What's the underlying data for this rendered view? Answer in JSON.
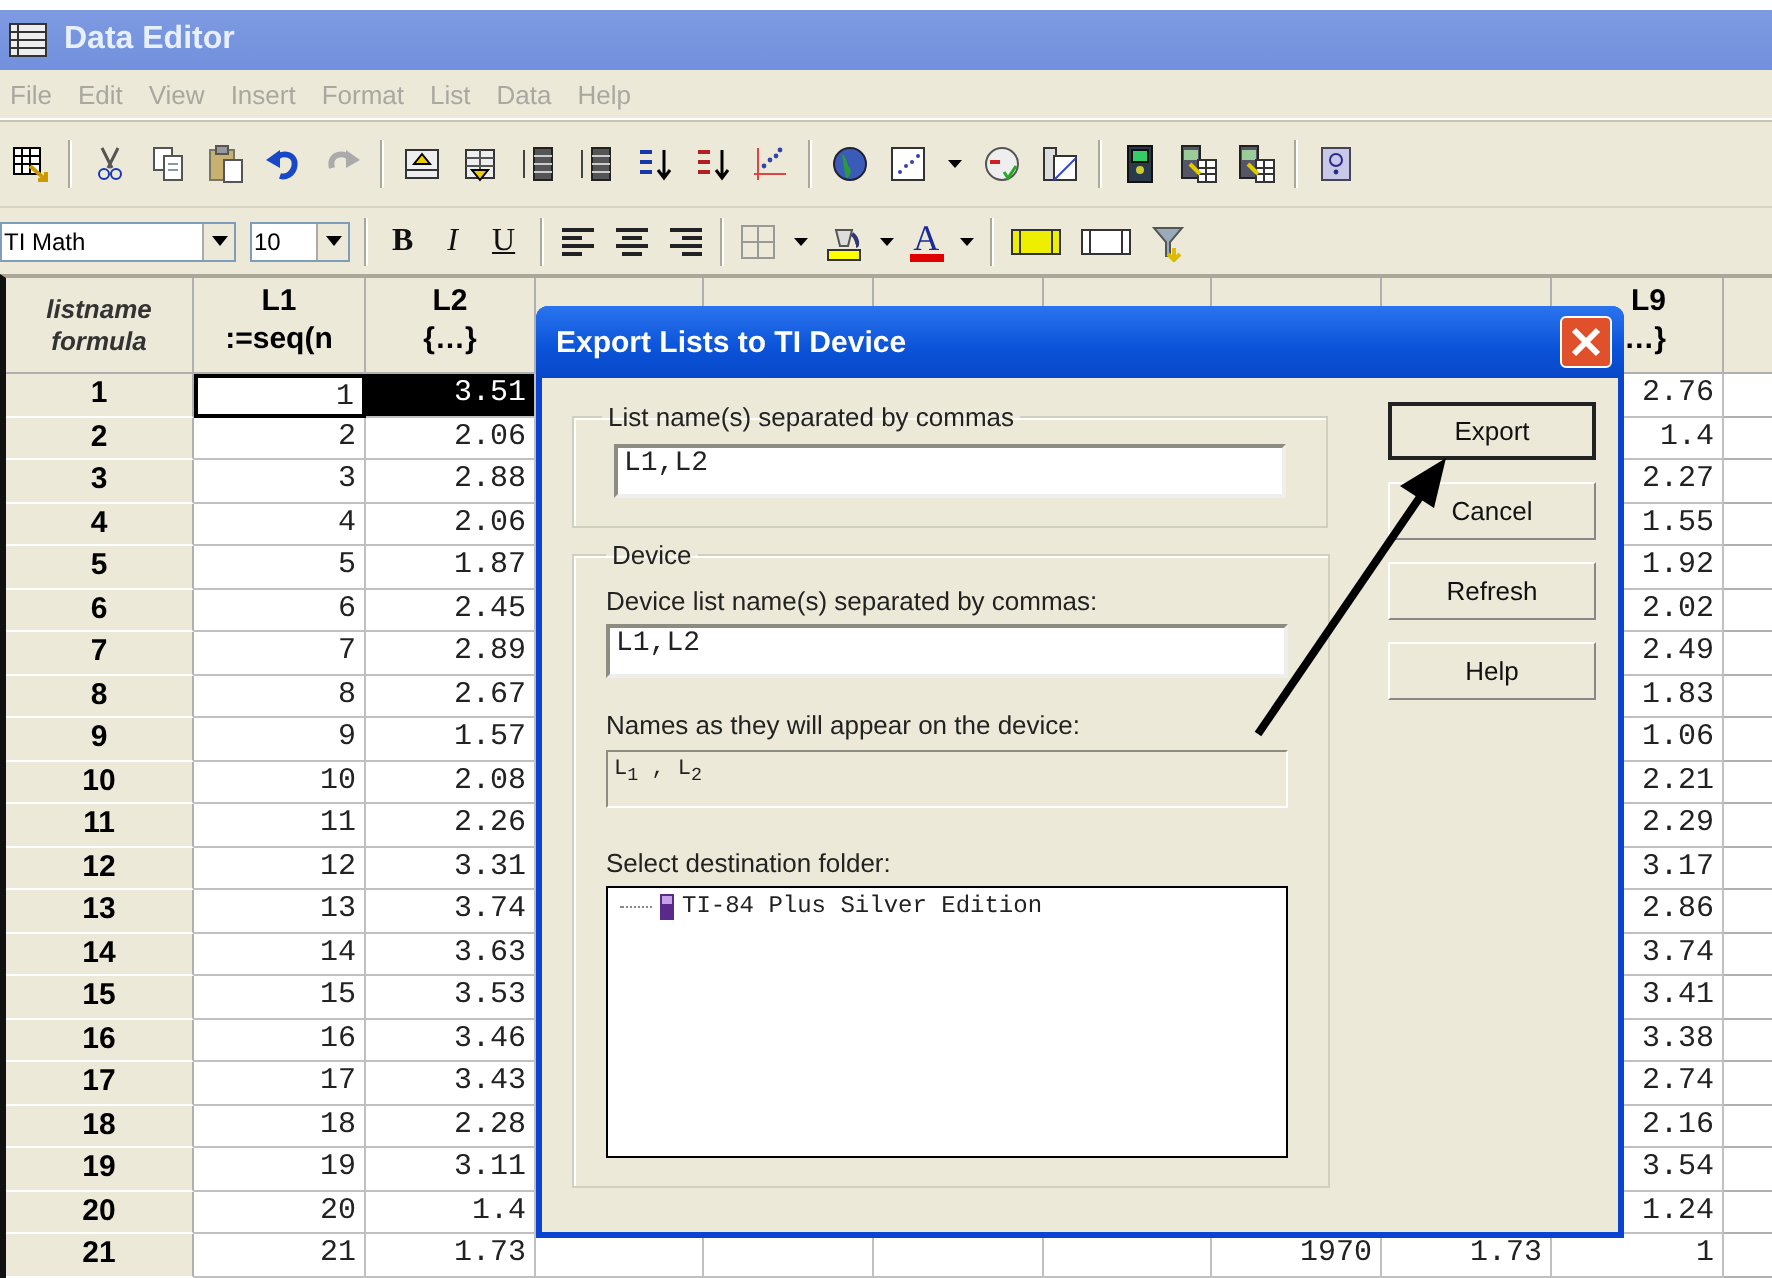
{
  "window": {
    "title": "Data Editor"
  },
  "menu": [
    "File",
    "Edit",
    "View",
    "Insert",
    "Format",
    "List",
    "Data",
    "Help"
  ],
  "font_box": {
    "value": "TI Math"
  },
  "size_box": {
    "value": "10"
  },
  "format_buttons": [
    {
      "label": "B",
      "kind": "bold"
    },
    {
      "label": "I",
      "kind": "italic"
    },
    {
      "label": "U",
      "kind": "underline"
    }
  ],
  "font_color_button": {
    "label": "A"
  },
  "table": {
    "corner": [
      "listname",
      "formula"
    ],
    "columns": [
      {
        "name": "L1",
        "formula": ":=seq(n"
      },
      {
        "name": "L2",
        "formula": "{…}"
      },
      null,
      null,
      null,
      null,
      null,
      null,
      {
        "name": "L9",
        "formula": "…}"
      }
    ],
    "rows": [
      {
        "label": "1",
        "selected": true,
        "cells": [
          "1",
          "3.51",
          null,
          null,
          null,
          null,
          null,
          null,
          "2.76"
        ]
      },
      {
        "label": "2",
        "selected": false,
        "cells": [
          "2",
          "2.06",
          null,
          null,
          null,
          null,
          null,
          null,
          "1.4"
        ]
      },
      {
        "label": "3",
        "selected": false,
        "cells": [
          "3",
          "2.88",
          null,
          null,
          null,
          null,
          null,
          null,
          "2.27"
        ]
      },
      {
        "label": "4",
        "selected": false,
        "cells": [
          "4",
          "2.06",
          null,
          null,
          null,
          null,
          null,
          null,
          "1.55"
        ]
      },
      {
        "label": "5",
        "selected": false,
        "cells": [
          "5",
          "1.87",
          null,
          null,
          null,
          null,
          null,
          null,
          "1.92"
        ]
      },
      {
        "label": "6",
        "selected": false,
        "cells": [
          "6",
          "2.45",
          null,
          null,
          null,
          null,
          null,
          null,
          "2.02"
        ]
      },
      {
        "label": "7",
        "selected": false,
        "cells": [
          "7",
          "2.89",
          null,
          null,
          null,
          null,
          null,
          null,
          "2.49"
        ]
      },
      {
        "label": "8",
        "selected": false,
        "cells": [
          "8",
          "2.67",
          null,
          null,
          null,
          null,
          null,
          null,
          "1.83"
        ]
      },
      {
        "label": "9",
        "selected": false,
        "cells": [
          "9",
          "1.57",
          null,
          null,
          null,
          null,
          null,
          null,
          "1.06"
        ]
      },
      {
        "label": "10",
        "selected": false,
        "cells": [
          "10",
          "2.08",
          null,
          null,
          null,
          null,
          null,
          null,
          "2.21"
        ]
      },
      {
        "label": "11",
        "selected": false,
        "cells": [
          "11",
          "2.26",
          null,
          null,
          null,
          null,
          null,
          null,
          "2.29"
        ]
      },
      {
        "label": "12",
        "selected": false,
        "cells": [
          "12",
          "3.31",
          null,
          null,
          null,
          null,
          null,
          null,
          "3.17"
        ]
      },
      {
        "label": "13",
        "selected": false,
        "cells": [
          "13",
          "3.74",
          null,
          null,
          null,
          null,
          null,
          null,
          "2.86"
        ]
      },
      {
        "label": "14",
        "selected": false,
        "cells": [
          "14",
          "3.63",
          null,
          null,
          null,
          null,
          null,
          null,
          "3.74"
        ]
      },
      {
        "label": "15",
        "selected": false,
        "cells": [
          "15",
          "3.53",
          null,
          null,
          null,
          null,
          null,
          null,
          "3.41"
        ]
      },
      {
        "label": "16",
        "selected": false,
        "cells": [
          "16",
          "3.46",
          null,
          null,
          null,
          null,
          null,
          null,
          "3.38"
        ]
      },
      {
        "label": "17",
        "selected": false,
        "cells": [
          "17",
          "3.43",
          null,
          null,
          null,
          null,
          null,
          null,
          "2.74"
        ]
      },
      {
        "label": "18",
        "selected": false,
        "cells": [
          "18",
          "2.28",
          null,
          null,
          null,
          null,
          null,
          null,
          "2.16"
        ]
      },
      {
        "label": "19",
        "selected": false,
        "cells": [
          "19",
          "3.11",
          null,
          null,
          null,
          null,
          null,
          null,
          "3.54"
        ]
      },
      {
        "label": "20",
        "selected": false,
        "cells": [
          "20",
          "1.4",
          null,
          null,
          null,
          null,
          null,
          null,
          "1.24"
        ]
      },
      {
        "label": "21",
        "selected": false,
        "cells": [
          "21",
          "1.73",
          null,
          null,
          null,
          null,
          "1970",
          "1.73",
          "1"
        ]
      }
    ]
  },
  "dialog": {
    "title": "Export Lists to TI Device",
    "list_group": {
      "legend": "List name(s) separated by commas",
      "value": "L1,L2"
    },
    "device_group": {
      "legend": "Device",
      "device_label": "Device list name(s) separated by commas:",
      "device_value": "L1,L2",
      "names_label": "Names as they will appear on the device:",
      "names_value": "L$_{1}$ , L$_{2}$",
      "folder_label": "Select destination folder:",
      "folders": [
        "TI-84 Plus Silver Edition"
      ]
    },
    "buttons": [
      {
        "label": "Export",
        "default": true
      },
      {
        "label": "Cancel",
        "default": false
      },
      {
        "label": "Refresh",
        "default": false
      },
      {
        "label": "Help",
        "default": false
      }
    ]
  }
}
